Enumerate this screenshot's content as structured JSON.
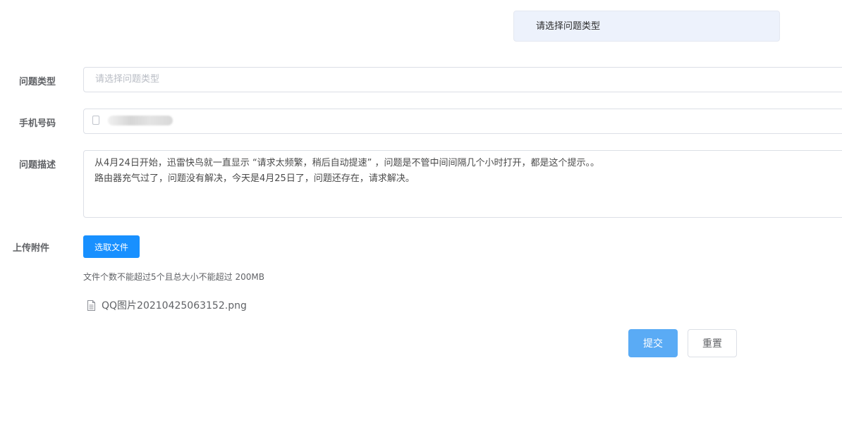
{
  "tooltip": {
    "text": "请选择问题类型"
  },
  "form": {
    "type_label": "问题类型",
    "type_placeholder": "请选择问题类型",
    "phone_label": "手机号码",
    "phone_icon": "mobile-phone-icon",
    "phone_value": "",
    "desc_label": "问题描述",
    "desc_lines": [
      "从4月24日开始，迅雷快鸟就一直显示 “请求太频繁，稍后自动提速” ，问题是不管中间间隔几个小时打开，都是这个提示。。",
      "路由器充气过了，问题没有解决，今天是4月25日了，问题还存在，请求解决。"
    ],
    "upload_label": "上传附件",
    "upload_button": "选取文件",
    "upload_tip": "文件个数不能超过5个且总大小不能超过 200MB",
    "files": [
      {
        "icon": "document-icon",
        "name": "QQ图片20210425063152.png"
      }
    ]
  },
  "actions": {
    "submit": "提交",
    "reset": "重置"
  },
  "colors": {
    "primary": "#1890ff",
    "submit_bg": "#5aabf5",
    "tooltip_bg": "#edf2fc",
    "border": "#dcdfe6"
  }
}
